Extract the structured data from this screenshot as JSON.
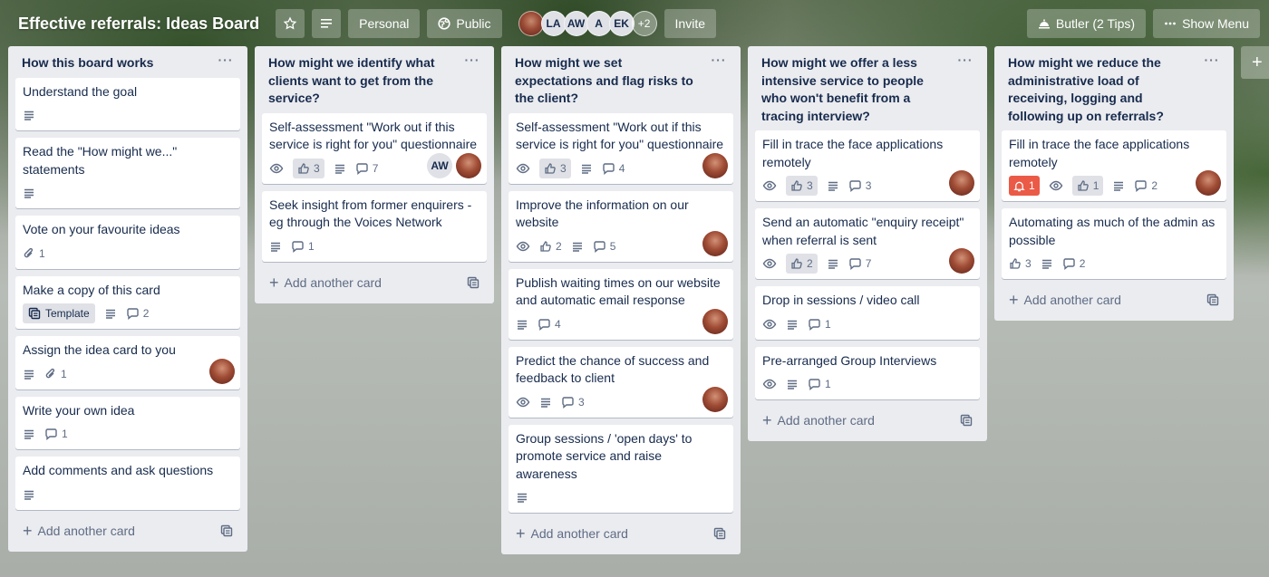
{
  "header": {
    "title": "Effective referrals: Ideas Board",
    "star_icon": "star-icon",
    "personal_label": "Personal",
    "public_label": "Public",
    "avatars": [
      "LA",
      "AW",
      "A",
      "EK"
    ],
    "more_members": "+2",
    "invite_label": "Invite",
    "butler_label": "Butler (2 Tips)",
    "show_menu_label": "Show Menu"
  },
  "lists": [
    {
      "title": "How this board works",
      "cards": [
        {
          "title": "Understand the goal",
          "desc": true
        },
        {
          "title": "Read the \"How might we...\" statements",
          "desc": true
        },
        {
          "title": "Vote on your favourite ideas",
          "attachments": "1"
        },
        {
          "title": "Make a copy of this card",
          "template": "Template",
          "desc": true,
          "comments": "2"
        },
        {
          "title": "Assign the idea card to you",
          "desc": true,
          "attachments": "1",
          "member_photo": true
        },
        {
          "title": "Write your own idea",
          "desc": true,
          "comments": "1"
        },
        {
          "title": "Add comments and ask questions",
          "desc": true
        }
      ],
      "add_label": "Add another card"
    },
    {
      "title": "How might we identify what clients want to get from the service?",
      "cards": [
        {
          "title": "Self-assessment \"Work out if this service is right for you\" questionnaire",
          "watch": true,
          "votes": "3",
          "voted": true,
          "desc": true,
          "comments": "7",
          "member_initials": "AW",
          "member_photo": true
        },
        {
          "title": "Seek insight from former enquirers - eg through the Voices Network",
          "desc": true,
          "comments": "1"
        }
      ],
      "add_label": "Add another card"
    },
    {
      "title": "How might we set expectations and flag risks to the client?",
      "cards": [
        {
          "title": "Self-assessment \"Work out if this service is right for you\" questionnaire",
          "watch": true,
          "votes": "3",
          "voted": true,
          "desc": true,
          "comments": "4",
          "member_photo": true
        },
        {
          "title": "Improve the information on our website",
          "watch": true,
          "votes": "2",
          "desc": true,
          "comments": "5",
          "member_photo": true
        },
        {
          "title": "Publish waiting times on our website and automatic email response",
          "desc": true,
          "comments": "4",
          "member_photo": true
        },
        {
          "title": "Predict the chance of success and feedback to client",
          "watch": true,
          "desc": true,
          "comments": "3",
          "member_photo": true
        },
        {
          "title": "Group sessions / 'open days' to promote service and raise awareness",
          "desc": true
        }
      ],
      "add_label": "Add another card"
    },
    {
      "title": "How might we offer a less intensive service to people who won't benefit from a tracing interview?",
      "cards": [
        {
          "title": "Fill in trace the face applications remotely",
          "watch": true,
          "votes": "3",
          "voted": true,
          "desc": true,
          "comments": "3",
          "member_photo": true
        },
        {
          "title": "Send an automatic \"enquiry receipt\" when referral is sent",
          "watch": true,
          "votes": "2",
          "voted": true,
          "desc": true,
          "comments": "7",
          "member_photo": true
        },
        {
          "title": "Drop in sessions / video call",
          "watch": true,
          "desc": true,
          "comments": "1"
        },
        {
          "title": "Pre-arranged Group Interviews",
          "watch": true,
          "desc": true,
          "comments": "1"
        }
      ],
      "add_label": "Add another card"
    },
    {
      "title": "How might we reduce the administrative load of receiving, logging and following up on referrals?",
      "cards": [
        {
          "title": "Fill in trace the face applications remotely",
          "due": "1",
          "watch": true,
          "votes": "1",
          "voted": true,
          "desc": true,
          "comments": "2",
          "member_photo": true
        },
        {
          "title": "Automating as much of the admin as possible",
          "votes": "3",
          "desc": true,
          "comments": "2"
        }
      ],
      "add_label": "Add another card"
    }
  ],
  "add_list_icon": "plus-icon"
}
